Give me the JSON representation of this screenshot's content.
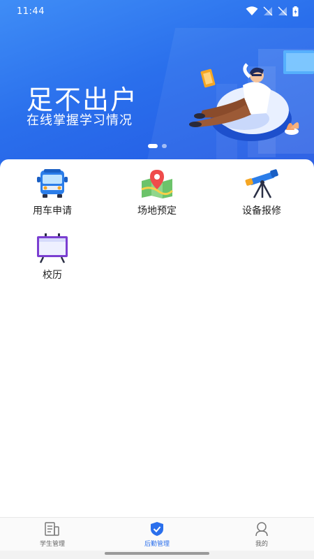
{
  "status_bar": {
    "time": "11:44"
  },
  "banner": {
    "headline": "足不出户",
    "subline": "在线掌握学习情况",
    "page_count": 2,
    "active_page": 1
  },
  "menu": {
    "items": [
      {
        "label": "用车申请",
        "icon": "bus-icon"
      },
      {
        "label": "场地预定",
        "icon": "map-pin-icon"
      },
      {
        "label": "设备报修",
        "icon": "telescope-icon"
      },
      {
        "label": "校历",
        "icon": "calendar-board-icon"
      }
    ]
  },
  "bottom_nav": {
    "items": [
      {
        "label": "学生管理",
        "icon": "student-book-icon",
        "active": false
      },
      {
        "label": "后勤管理",
        "icon": "shield-check-icon",
        "active": true
      },
      {
        "label": "我的",
        "icon": "profile-icon",
        "active": false
      }
    ]
  },
  "colors": {
    "accent": "#2a6fec",
    "banner_top": "#3f8df6",
    "banner_bottom": "#2358e3"
  }
}
